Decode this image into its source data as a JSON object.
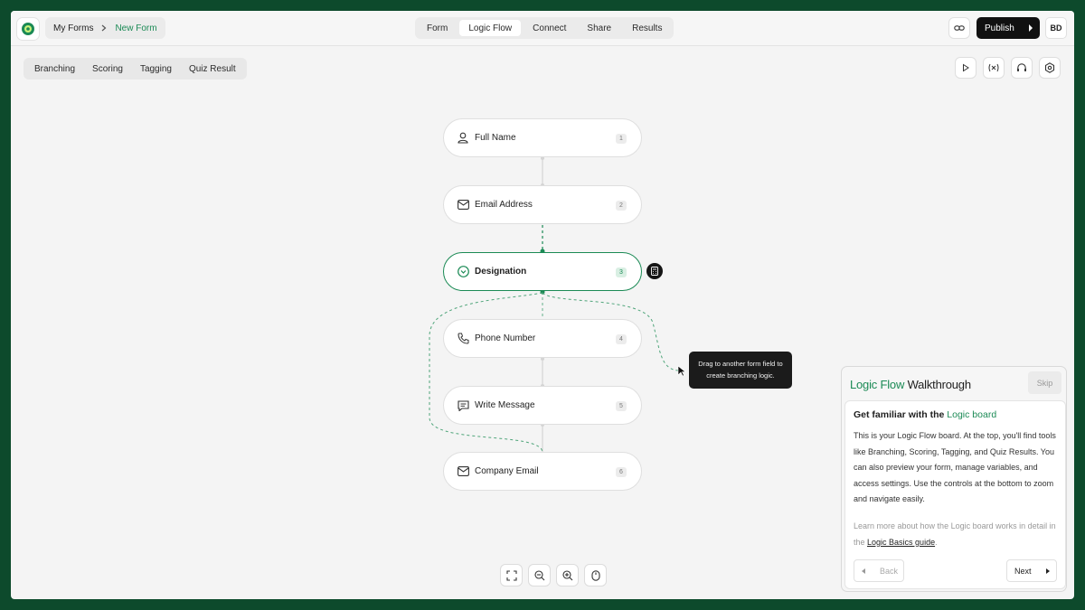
{
  "header": {
    "breadcrumb": [
      {
        "label": "My Forms"
      },
      {
        "label": "New Form"
      }
    ],
    "tabs": [
      {
        "label": "Form",
        "active": false
      },
      {
        "label": "Logic Flow",
        "active": true
      },
      {
        "label": "Connect",
        "active": false
      },
      {
        "label": "Share",
        "active": false
      },
      {
        "label": "Results",
        "active": false
      }
    ],
    "link_icon": "link-icon",
    "publish_label": "Publish",
    "avatar_initials": "BD"
  },
  "toolbar": {
    "tabs": [
      {
        "label": "Branching"
      },
      {
        "label": "Scoring"
      },
      {
        "label": "Tagging"
      },
      {
        "label": "Quiz Result"
      }
    ],
    "tools": [
      "play-icon",
      "variables-icon",
      "headset-icon",
      "settings-icon"
    ]
  },
  "nodes": [
    {
      "label": "Full Name",
      "num": "1",
      "icon": "person-icon",
      "selected": false
    },
    {
      "label": "Email Address",
      "num": "2",
      "icon": "mail-icon",
      "selected": false
    },
    {
      "label": "Designation",
      "num": "3",
      "icon": "chevron-circle-icon",
      "selected": true
    },
    {
      "label": "Phone Number",
      "num": "4",
      "icon": "phone-icon",
      "selected": false
    },
    {
      "label": "Write Message",
      "num": "5",
      "icon": "message-icon",
      "selected": false
    },
    {
      "label": "Company Email",
      "num": "6",
      "icon": "mail-icon",
      "selected": false
    }
  ],
  "tooltip": {
    "line1": "Drag to another form field to",
    "line2": "create branching logic."
  },
  "zoom_controls": [
    "fit-screen-icon",
    "zoom-out-icon",
    "zoom-in-icon",
    "mouse-icon"
  ],
  "walkthrough": {
    "title_accent": "Logic Flow",
    "title_rest": "Walkthrough",
    "skip_label": "Skip",
    "heading_prefix": "Get familiar with the",
    "heading_accent": "Logic board",
    "body": "This is your Logic Flow board. At the top, you'll find tools like Branching, Scoring, Tagging, and Quiz Results. You can also preview your form, manage variables, and access settings. Use the controls at the bottom to zoom and navigate easily.",
    "more_prefix": "Learn more about how the Logic board works in detail in the",
    "more_link": "Logic Basics guide",
    "more_suffix": ".",
    "back_label": "Back",
    "next_label": "Next"
  },
  "colors": {
    "accent": "#1b8a55",
    "frame": "#0d4a2c",
    "canvas": "#f4f4f4",
    "dark": "#111111"
  }
}
